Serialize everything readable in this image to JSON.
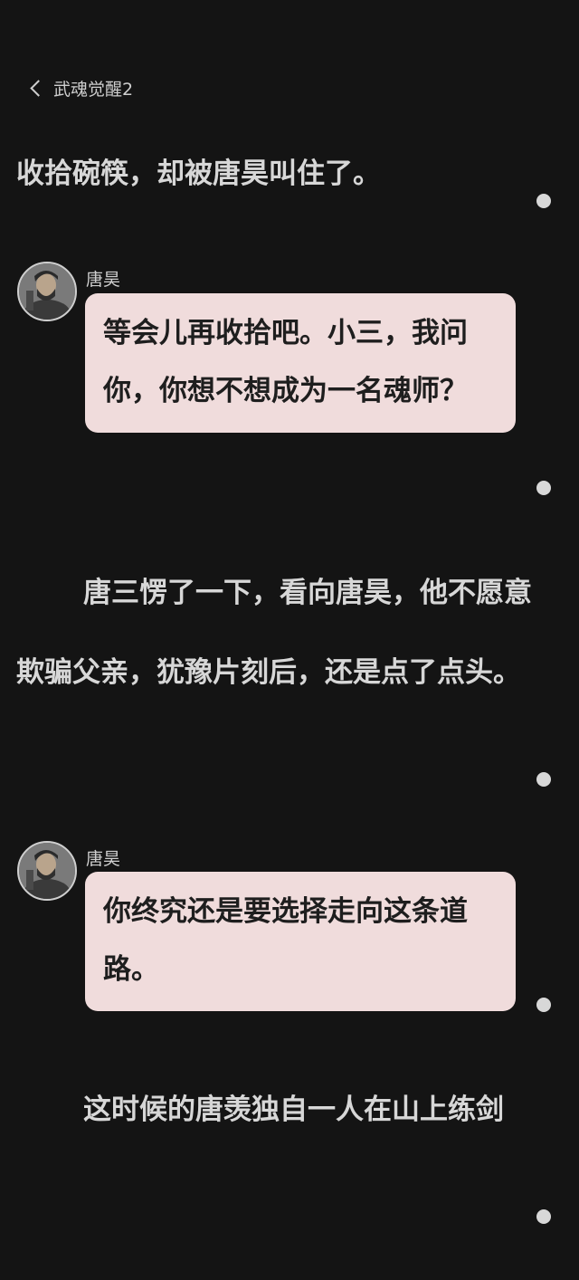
{
  "header": {
    "back_icon": "chevron-left-icon",
    "title": "武魂觉醒2"
  },
  "story": {
    "p1": "收拾碗筷，却被唐昊叫住了。",
    "msg1": {
      "speaker": "唐昊",
      "text": "等会儿再收拾吧。小三，我问你，你想不想成为一名魂师？"
    },
    "p2": "唐三愣了一下，看向唐昊，他不愿意欺骗父亲，犹豫片刻后，还是点了点头。",
    "msg2": {
      "speaker": "唐昊",
      "text": "你终究还是要选择走向这条道路。"
    },
    "p3": "这时候的唐羡独自一人在山上练剑"
  },
  "colors": {
    "background": "#141414",
    "bubble": "#f0dcdc",
    "text": "#d7d7d7"
  }
}
